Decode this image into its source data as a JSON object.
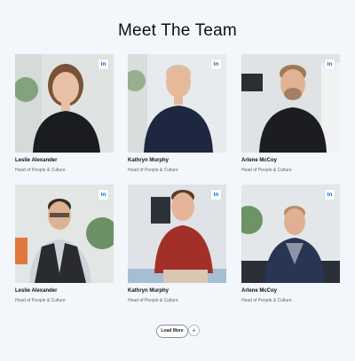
{
  "page": {
    "title": "Meet The Team"
  },
  "linkedin_label": "in",
  "team": [
    {
      "name": "Leslie Alexander",
      "role": "Head of People & Culture",
      "bg": "#dfe4e3",
      "shirt": "#1b1c22",
      "skin": "#e7c0a6",
      "hair": "#7a5238"
    },
    {
      "name": "Kathryn Murphy",
      "role": "Head of People & Culture",
      "bg": "#e7ebee",
      "shirt": "#1d2740",
      "skin": "#e6b99a",
      "hair": "#d8c0a8"
    },
    {
      "name": "Arlene McCoy",
      "role": "Head of People & Culture",
      "bg": "#dfe3e6",
      "shirt": "#1c1d22",
      "skin": "#e2b294",
      "hair": "#a07a52"
    },
    {
      "name": "Leslie Alexander",
      "role": "Head of People & Culture",
      "bg": "#e2e6e4",
      "shirt": "#2a2b30",
      "skin": "#dcb293",
      "hair": "#3a2c22"
    },
    {
      "name": "Kathryn Murphy",
      "role": "Head of People & Culture",
      "bg": "#dfe2e6",
      "shirt": "#a33028",
      "skin": "#e4b598",
      "hair": "#5b3c26"
    },
    {
      "name": "Arlene McCoy",
      "role": "Head of People & Culture",
      "bg": "#e3e7ea",
      "shirt": "#2a3556",
      "skin": "#e1b092",
      "hair": "#b59066"
    }
  ],
  "actions": {
    "load_more": "Load More",
    "plus": "+"
  }
}
